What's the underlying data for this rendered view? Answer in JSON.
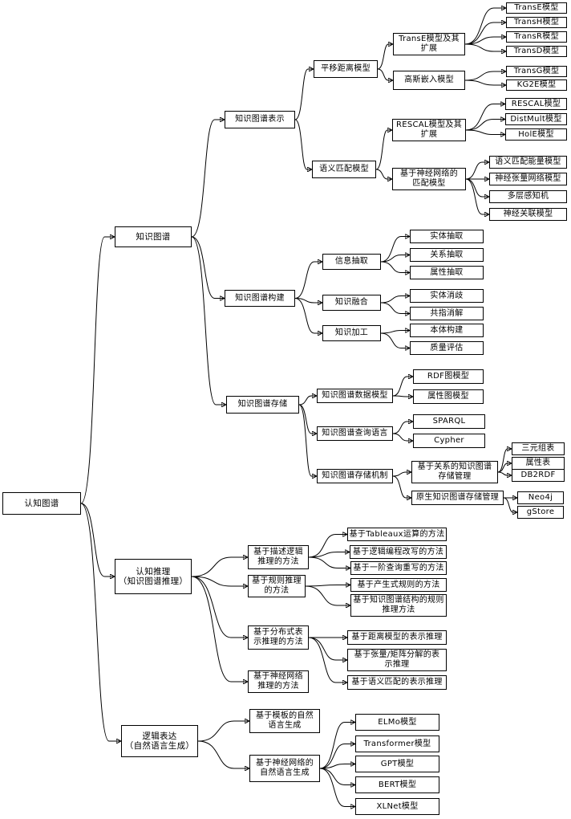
{
  "nodes": {
    "root": "认知图谱",
    "kg": "知识图谱",
    "kg_repr": "知识图谱表示",
    "translation_model": "平移距离模型",
    "transe_ext": "TransE模型及其\n扩展",
    "transe": "TransE模型",
    "transh": "TransH模型",
    "transr": "TransR模型",
    "transd": "TransD模型",
    "gaussian_embed": "高斯嵌入模型",
    "transg": "TransG模型",
    "kg2e": "KG2E模型",
    "semantic_match": "语义匹配模型",
    "rescal_ext": "RESCAL模型及其\n扩展",
    "rescal": "RESCAL模型",
    "distmult": "DistMult模型",
    "hole": "HolE模型",
    "nn_match": "基于神经网络的\n匹配模型",
    "sme": "语义匹配能量模型",
    "ntn": "神经张量网络模型",
    "mlp": "多层感知机",
    "nam": "神经关联模型",
    "kg_build": "知识图谱构建",
    "info_extract": "信息抽取",
    "entity_extract": "实体抽取",
    "relation_extract": "关系抽取",
    "attr_extract": "属性抽取",
    "knowledge_fusion": "知识融合",
    "entity_disamb": "实体消歧",
    "coref": "共指消解",
    "knowledge_proc": "知识加工",
    "ontology": "本体构建",
    "quality": "质量评估",
    "kg_storage": "知识图谱存储",
    "kg_data_model": "知识图谱数据模型",
    "rdf_model": "RDF图模型",
    "property_graph": "属性图模型",
    "kg_query_lang": "知识图谱查询语言",
    "sparql": "SPARQL",
    "cypher": "Cypher",
    "kg_storage_mech": "知识图谱存储机制",
    "relational_storage": "基于关系的知识图谱\n存储管理",
    "triple_table": "三元组表",
    "property_table": "属性表",
    "db2rdf": "DB2RDF",
    "native_storage": "原生知识图谱存储管理",
    "neo4j": "Neo4j",
    "gstore": "gStore",
    "cog_reason": "认知推理\n（知识图谱推理）",
    "dl_reason": "基于描述逻辑\n推理的方法",
    "tableaux": "基于Tableaux运算的方法",
    "logic_prog": "基于逻辑编程改写的方法",
    "fol_query": "基于一阶查询重写的方法",
    "rule_reason": "基于规则推理\n的方法",
    "production_rule": "基于产生式规则的方法",
    "kg_struct_rule": "基于知识图谱结构的规则\n推理方法",
    "distributed_repr": "基于分布式表\n示推理的方法",
    "distance_repr": "基于距离模型的表示推理",
    "tensor_repr": "基于张量/矩阵分解的表\n示推理",
    "semantic_repr": "基于语义匹配的表示推理",
    "nn_reason": "基于神经网络\n推理的方法",
    "logic_expr": "逻辑表达\n（自然语言生成）",
    "template_nlg": "基于模板的自然\n语言生成",
    "nn_nlg": "基于神经网络的\n自然语言生成",
    "elmo": "ELMo模型",
    "transformer": "Transformer模型",
    "gpt": "GPT模型",
    "bert": "BERT模型",
    "xlnet": "XLNet模型"
  }
}
